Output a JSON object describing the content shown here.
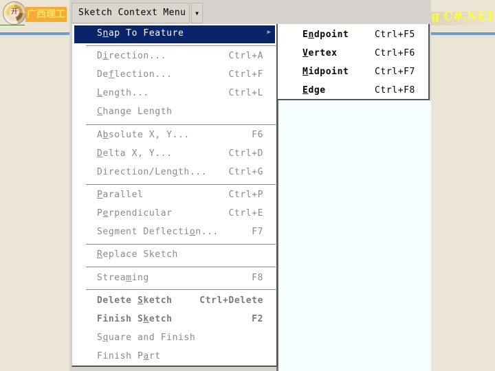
{
  "slide": {
    "school_name": "广西理工",
    "banner_title": "Using C#.NET",
    "logo_glyph": "开",
    "colors": {
      "background": "#ebe5d6",
      "accent_blue": "#6e9bc7",
      "banner_text": "#ffff33",
      "school_bg": "#f5a623"
    }
  },
  "toolbar": {
    "combo_label": "Sketch Context Menu",
    "dropdown_icon": "chevron-down-icon"
  },
  "menu": {
    "highlight_color": "#0a246a",
    "items": [
      {
        "pre": "S",
        "u": "n",
        "post": "ap To Feature",
        "shortcut": "",
        "submenu": true,
        "enabled": true
      },
      {
        "pre": "D",
        "u": "i",
        "post": "rection...",
        "shortcut": "Ctrl+A",
        "enabled": false
      },
      {
        "pre": "De",
        "u": "f",
        "post": "lection...",
        "shortcut": "Ctrl+F",
        "enabled": false
      },
      {
        "pre": "",
        "u": "L",
        "post": "ength...",
        "shortcut": "Ctrl+L",
        "enabled": false
      },
      {
        "pre": "",
        "u": "C",
        "post": "hange Length",
        "shortcut": "",
        "enabled": false
      },
      {
        "pre": "A",
        "u": "b",
        "post": "solute X, Y...",
        "shortcut": "F6",
        "enabled": false
      },
      {
        "pre": "",
        "u": "D",
        "post": "elta X, Y...",
        "shortcut": "Ctrl+D",
        "enabled": false
      },
      {
        "pre": "Direction/Len",
        "u": "g",
        "post": "th...",
        "shortcut": "Ctrl+G",
        "enabled": false
      },
      {
        "pre": "",
        "u": "P",
        "post": "arallel",
        "shortcut": "Ctrl+P",
        "enabled": false
      },
      {
        "pre": "P",
        "u": "e",
        "post": "rpendicular",
        "shortcut": "Ctrl+E",
        "enabled": false
      },
      {
        "pre": "Segment Deflecti",
        "u": "o",
        "post": "n...",
        "shortcut": "F7",
        "enabled": false
      },
      {
        "pre": "",
        "u": "R",
        "post": "eplace Sketch",
        "shortcut": "",
        "enabled": false
      },
      {
        "pre": "Strea",
        "u": "m",
        "post": "ing",
        "shortcut": "F8",
        "enabled": false
      },
      {
        "pre": "Delete ",
        "u": "S",
        "post": "ketch",
        "shortcut": "Ctrl+Delete",
        "enabled": false
      },
      {
        "pre": "Finish S",
        "u": "k",
        "post": "etch",
        "shortcut": "F2",
        "enabled": false
      },
      {
        "pre": "S",
        "u": "q",
        "post": "uare and Finish",
        "shortcut": "",
        "enabled": false
      },
      {
        "pre": "Finish P",
        "u": "a",
        "post": "rt",
        "shortcut": "",
        "enabled": false
      }
    ]
  },
  "submenu": {
    "items": [
      {
        "pre": "E",
        "u": "n",
        "post": "dpoint",
        "shortcut": "Ctrl+F5"
      },
      {
        "pre": "",
        "u": "V",
        "post": "ertex",
        "shortcut": "Ctrl+F6"
      },
      {
        "pre": "",
        "u": "M",
        "post": "idpoint",
        "shortcut": "Ctrl+F7"
      },
      {
        "pre": "",
        "u": "E",
        "post": "dge",
        "shortcut": "Ctrl+F8"
      }
    ]
  }
}
